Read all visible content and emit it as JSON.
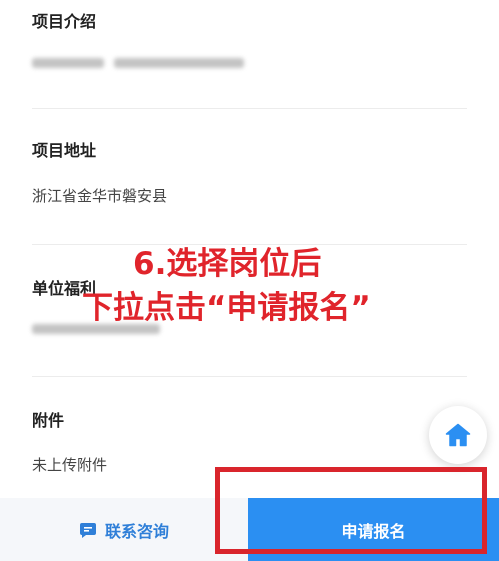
{
  "sections": [
    {
      "title": "项目介绍",
      "value": ""
    },
    {
      "title": "项目地址",
      "value": "浙江省金华市磐安县"
    },
    {
      "title": "单位福利",
      "value": ""
    },
    {
      "title": "附件",
      "value": "未上传附件"
    }
  ],
  "home_button": {
    "icon": "home-icon"
  },
  "bottom_bar": {
    "contact_label": "联系咨询",
    "contact_icon": "chat-icon",
    "apply_label": "申请报名"
  },
  "annotation": {
    "line1": "6.选择岗位后",
    "line2": "下拉点击“申请报名”"
  },
  "colors": {
    "accent": "#2b8ff2",
    "contact_text": "#2f7fd8",
    "annotation_red": "#e0242b"
  }
}
